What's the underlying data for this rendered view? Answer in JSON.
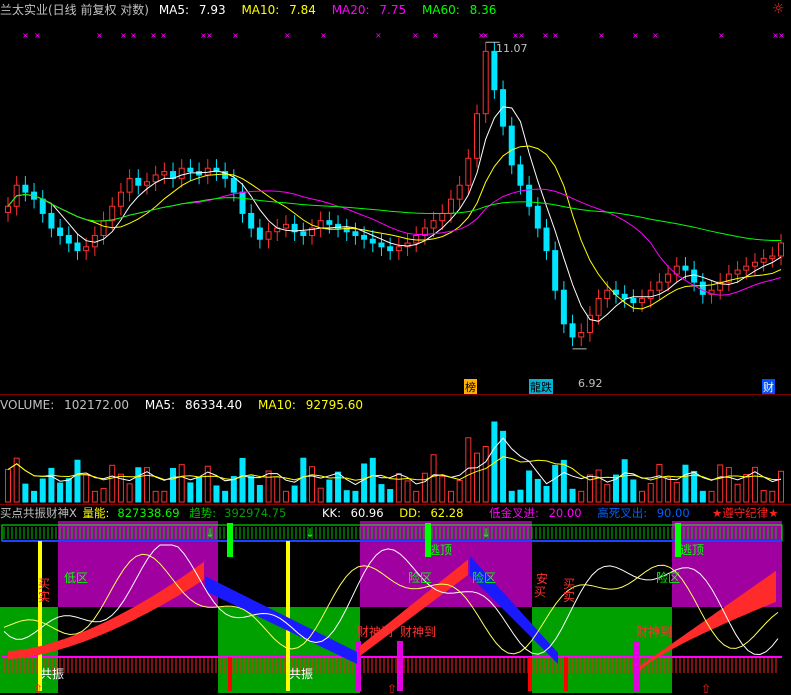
{
  "price_panel": {
    "header": {
      "name": "兰太实业(日线 前复权 对数)",
      "ma5_label": "MA5:",
      "ma5_value": "7.93",
      "ma10_label": "MA10:",
      "ma10_value": "7.84",
      "ma20_label": "MA20:",
      "ma20_value": "7.75",
      "ma60_label": "MA60:",
      "ma60_value": "8.36"
    },
    "high_label": "11.07",
    "low_label": "6.92",
    "tags": [
      "榜",
      "龍跌",
      "财"
    ],
    "colors": {
      "up": "#ff3030",
      "down": "#00e5ff",
      "ma5": "#ffffff",
      "ma10": "#ffff00",
      "ma20": "#ff00ff",
      "ma60": "#00ff00"
    }
  },
  "volume_panel": {
    "header": {
      "volume_label": "VOLUME:",
      "volume_value": "102172.00",
      "ma5_label": "MA5:",
      "ma5_value": "86334.40",
      "ma10_label": "MA10:",
      "ma10_value": "92795.60"
    }
  },
  "indicator_panel": {
    "header": {
      "name": "买点共振财神X",
      "energy_label": "量能:",
      "energy_value": "827338.69",
      "trend_label": "趋势:",
      "trend_value": "392974.75",
      "kk_label": "KK:",
      "kk_value": "60.96",
      "dd_label": "DD:",
      "dd_value": "62.28",
      "golden_label": "低金叉进:",
      "golden_value": "20.00",
      "dead_label": "高死叉出:",
      "dead_value": "90.00",
      "discipline": "★遵守纪律★"
    },
    "labels": {
      "zone_low": "低区",
      "zone_danger": "险区",
      "buy": "买",
      "real": "实",
      "resonance": "共振",
      "god_arrive": "财神到",
      "top_escape": "逃顶",
      "safe": "安"
    }
  },
  "chart_data": [
    {
      "type": "candlestick",
      "title": "兰太实业(日线 前复权 对数)",
      "annotations": {
        "high": 11.07,
        "low": 6.92
      },
      "series": [
        {
          "name": "MA5",
          "last": 7.93
        },
        {
          "name": "MA10",
          "last": 7.84
        },
        {
          "name": "MA20",
          "last": 7.75
        },
        {
          "name": "MA60",
          "last": 8.36
        }
      ],
      "close": [
        8.6,
        8.9,
        8.8,
        8.7,
        8.5,
        8.3,
        8.2,
        8.1,
        8.0,
        8.05,
        8.2,
        8.4,
        8.6,
        8.8,
        9.0,
        8.9,
        8.95,
        9.05,
        9.1,
        9.0,
        9.15,
        9.1,
        9.05,
        9.15,
        9.1,
        9.0,
        8.8,
        8.5,
        8.3,
        8.15,
        8.25,
        8.3,
        8.35,
        8.25,
        8.2,
        8.3,
        8.4,
        8.35,
        8.3,
        8.25,
        8.2,
        8.15,
        8.1,
        8.05,
        8.0,
        8.05,
        8.1,
        8.2,
        8.3,
        8.4,
        8.5,
        8.7,
        8.9,
        9.3,
        10.0,
        11.07,
        10.4,
        9.8,
        9.2,
        8.9,
        8.6,
        8.3,
        8.0,
        7.5,
        7.1,
        6.95,
        7.0,
        7.2,
        7.4,
        7.5,
        7.45,
        7.4,
        7.35,
        7.4,
        7.5,
        7.6,
        7.7,
        7.8,
        7.75,
        7.6,
        7.45,
        7.5,
        7.6,
        7.7,
        7.75,
        7.8,
        7.85,
        7.9,
        7.93,
        8.1
      ]
    },
    {
      "type": "bar",
      "title": "VOLUME",
      "series": [
        {
          "name": "VOLUME",
          "last": 102172.0
        },
        {
          "name": "MA5",
          "last": 86334.4
        },
        {
          "name": "MA10",
          "last": 92795.6
        }
      ]
    },
    {
      "type": "line",
      "title": "买点共振财神X",
      "series": [
        {
          "name": "量能",
          "last": 827338.69
        },
        {
          "name": "趋势",
          "last": 392974.75
        },
        {
          "name": "KK",
          "last": 60.96
        },
        {
          "name": "DD",
          "last": 62.28
        }
      ],
      "reference_lines": {
        "低金叉进": 20.0,
        "高死叉出": 90.0
      }
    }
  ]
}
